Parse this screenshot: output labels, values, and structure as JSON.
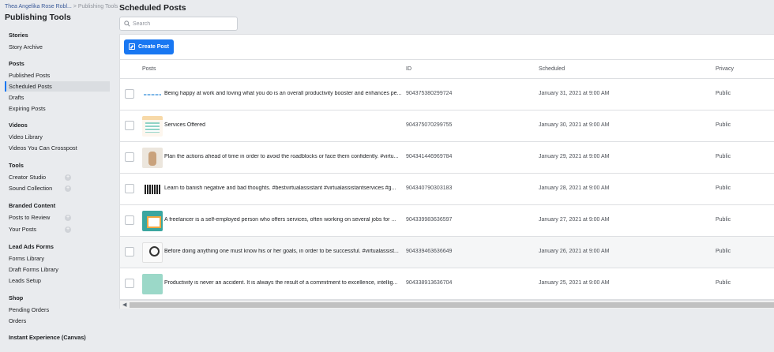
{
  "breadcrumb": {
    "parent": "Thea Angelika Rose Robl...",
    "separator": ">",
    "current": "Publishing Tools"
  },
  "sidebar": {
    "title": "Publishing Tools",
    "groups": [
      {
        "title": "Stories",
        "items": [
          {
            "label": "Story Archive"
          }
        ]
      },
      {
        "title": "Posts",
        "items": [
          {
            "label": "Published Posts"
          },
          {
            "label": "Scheduled Posts",
            "active": true
          },
          {
            "label": "Drafts"
          },
          {
            "label": "Expiring Posts"
          }
        ]
      },
      {
        "title": "Videos",
        "items": [
          {
            "label": "Video Library"
          },
          {
            "label": "Videos You Can Crosspost"
          }
        ]
      },
      {
        "title": "Tools",
        "items": [
          {
            "label": "Creator Studio",
            "icon": "plus-circle-icon"
          },
          {
            "label": "Sound Collection",
            "icon": "plus-circle-icon"
          }
        ]
      },
      {
        "title": "Branded Content",
        "items": [
          {
            "label": "Posts to Review",
            "icon": "plus-circle-icon"
          },
          {
            "label": "Your Posts",
            "icon": "plus-circle-icon"
          }
        ]
      },
      {
        "title": "Lead Ads Forms",
        "items": [
          {
            "label": "Forms Library"
          },
          {
            "label": "Draft Forms Library"
          },
          {
            "label": "Leads Setup"
          }
        ]
      },
      {
        "title": "Shop",
        "items": [
          {
            "label": "Pending Orders"
          },
          {
            "label": "Orders"
          }
        ]
      },
      {
        "title": "Instant Experience (Canvas)",
        "items": []
      }
    ]
  },
  "main": {
    "title": "Scheduled Posts",
    "search": {
      "placeholder": "Search",
      "value": ""
    },
    "create_button": "Create Post",
    "columns": {
      "posts": "Posts",
      "id": "ID",
      "scheduled": "Scheduled",
      "privacy": "Privacy"
    },
    "rows": [
      {
        "thumb": "line-graphic",
        "text": "Being happy at work and loving what you do is an overall productivity booster and enhances pe...",
        "id": "904375380299724",
        "scheduled": "January 31, 2021 at 9:00 AM",
        "privacy": "Public"
      },
      {
        "thumb": "services-graphic",
        "text": "Services Offered",
        "id": "904375070299755",
        "scheduled": "January 30, 2021 at 9:00 AM",
        "privacy": "Public"
      },
      {
        "thumb": "plan-photo",
        "text": "Plan the actions ahead of time in order to avoid the roadblocks or face them confidently. #virtu...",
        "id": "904341446969784",
        "scheduled": "January 29, 2021 at 9:00 AM",
        "privacy": "Public"
      },
      {
        "thumb": "banish-text-graphic",
        "text": "Learn to banish negative and bad thoughts. #bestvirtualassistant #virtualassistantservices #g...",
        "id": "904340790303183",
        "scheduled": "January 28, 2021 at 9:00 AM",
        "privacy": "Public"
      },
      {
        "thumb": "freelancer-graphic",
        "text": "A freelancer is a self-employed person who offers services, often working on several jobs for ...",
        "id": "904339983636597",
        "scheduled": "January 27, 2021 at 9:00 AM",
        "privacy": "Public"
      },
      {
        "thumb": "before-graphic",
        "text": "Before doing anything one must know his or her goals, in order to be successful. #virtualassist...",
        "id": "904339463636649",
        "scheduled": "January 26, 2021 at 9:00 AM",
        "privacy": "Public"
      },
      {
        "thumb": "productivity-graphic",
        "text": "Productivity is never an accident. It is always the result of a commitment to excellence, intellig...",
        "id": "904338913636704",
        "scheduled": "January 25, 2021 at 9:00 AM",
        "privacy": "Public"
      }
    ]
  },
  "colors": {
    "accent": "#1877f2",
    "link": "#385898",
    "background": "#e9ebee"
  }
}
